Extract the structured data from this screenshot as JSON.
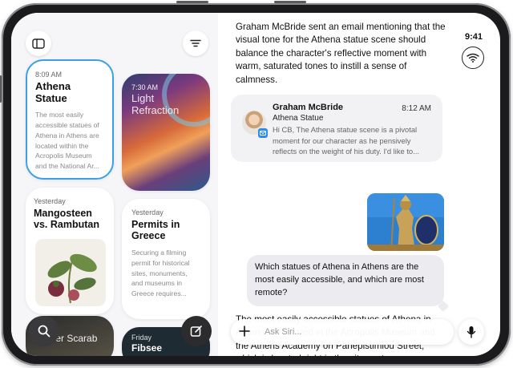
{
  "status": {
    "time": "9:41"
  },
  "notes": [
    {
      "time": "8:09 AM",
      "title": "Athena Statue",
      "preview": "The most easily accessible statues of Athena in Athens are located within the Acropolis Museum and the National Ar..."
    },
    {
      "time": "7:30 AM",
      "title": "Light Refraction"
    },
    {
      "time": "Yesterday",
      "title": "Mangosteen vs. Rambutan"
    },
    {
      "time": "Yesterday",
      "title": "Permits in Greece",
      "preview": "Securing a filming permit for historical sites, monuments, and museums in Greece requires..."
    },
    {
      "title": "Flower Scarab"
    },
    {
      "time": "Friday",
      "title": "Fibsee"
    }
  ],
  "chat": {
    "assistant_message_1": "Graham McBride sent an email mentioning that the visual tone for the Athena statue scene should balance the character's reflective moment with warm, saturated tones to instill a sense of calmness.",
    "email": {
      "sender": "Graham McBride",
      "time": "8:12 AM",
      "subject": "Athena Statue",
      "preview": "Hi CB, The Athena statue scene is a pivotal moment for our character as he pensively reflects on the weight of his duty. I'd like to..."
    },
    "user_message": "Which statues of Athena in Athens are the most easily accessible, and which are most remote?",
    "assistant_message_2": "The most easily accessible statues of Athena in Athens are located in the Acropolis Museum and the Athens Academy on Panepistimiou Street, which is located right in the city center."
  },
  "input": {
    "placeholder": "Ask Siri..."
  },
  "colors": {
    "accent": "#3aa0e8",
    "mail_badge": "#2a8cf0"
  }
}
